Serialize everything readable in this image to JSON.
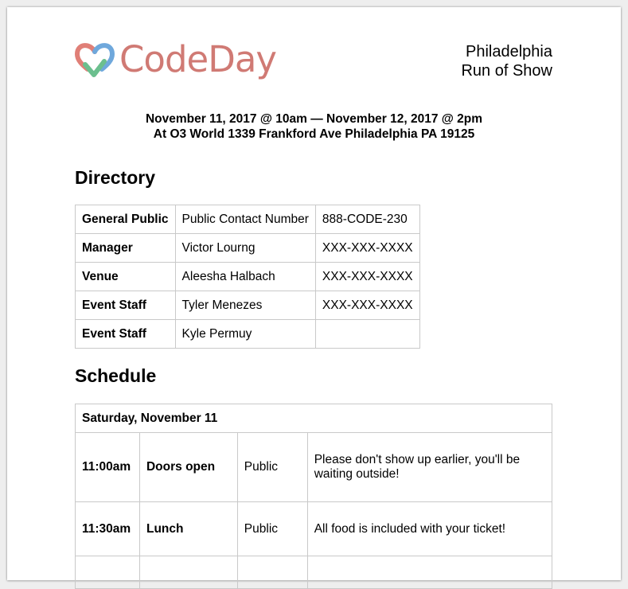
{
  "header": {
    "logo_text": "CodeDay",
    "city": "Philadelphia",
    "doc_type": "Run of Show"
  },
  "event": {
    "dates": "November 11, 2017 @ 10am — November 12, 2017 @ 2pm",
    "location": "At O3 World 1339 Frankford Ave Philadelphia PA 19125"
  },
  "directory": {
    "heading": "Directory",
    "rows": [
      {
        "role": "General Public",
        "name": "Public Contact Number",
        "phone": "888-CODE-230"
      },
      {
        "role": "Manager",
        "name": "Victor Lourng",
        "phone": "XXX-XXX-XXXX"
      },
      {
        "role": "Venue",
        "name": "Aleesha Halbach",
        "phone": "XXX-XXX-XXXX"
      },
      {
        "role": "Event Staff",
        "name": "Tyler Menezes",
        "phone": "XXX-XXX-XXXX"
      },
      {
        "role": "Event Staff",
        "name": "Kyle Permuy",
        "phone": ""
      }
    ]
  },
  "schedule": {
    "heading": "Schedule",
    "day": "Saturday, November 11",
    "rows": [
      {
        "time": "11:00am",
        "event": "Doors open",
        "audience": "Public",
        "notes": "Please don't show up earlier, you'll be waiting outside!"
      },
      {
        "time": "11:30am",
        "event": "Lunch",
        "audience": "Public",
        "notes": "All food is included with your ticket!"
      },
      {
        "time": "",
        "event": "",
        "audience": "",
        "notes": ""
      }
    ]
  },
  "colors": {
    "logo_text": "#d07a74",
    "heart_left": "#e07f77",
    "heart_right": "#6fa8dc",
    "check": "#6bbf8e",
    "table_border": "#c9c9c9"
  }
}
